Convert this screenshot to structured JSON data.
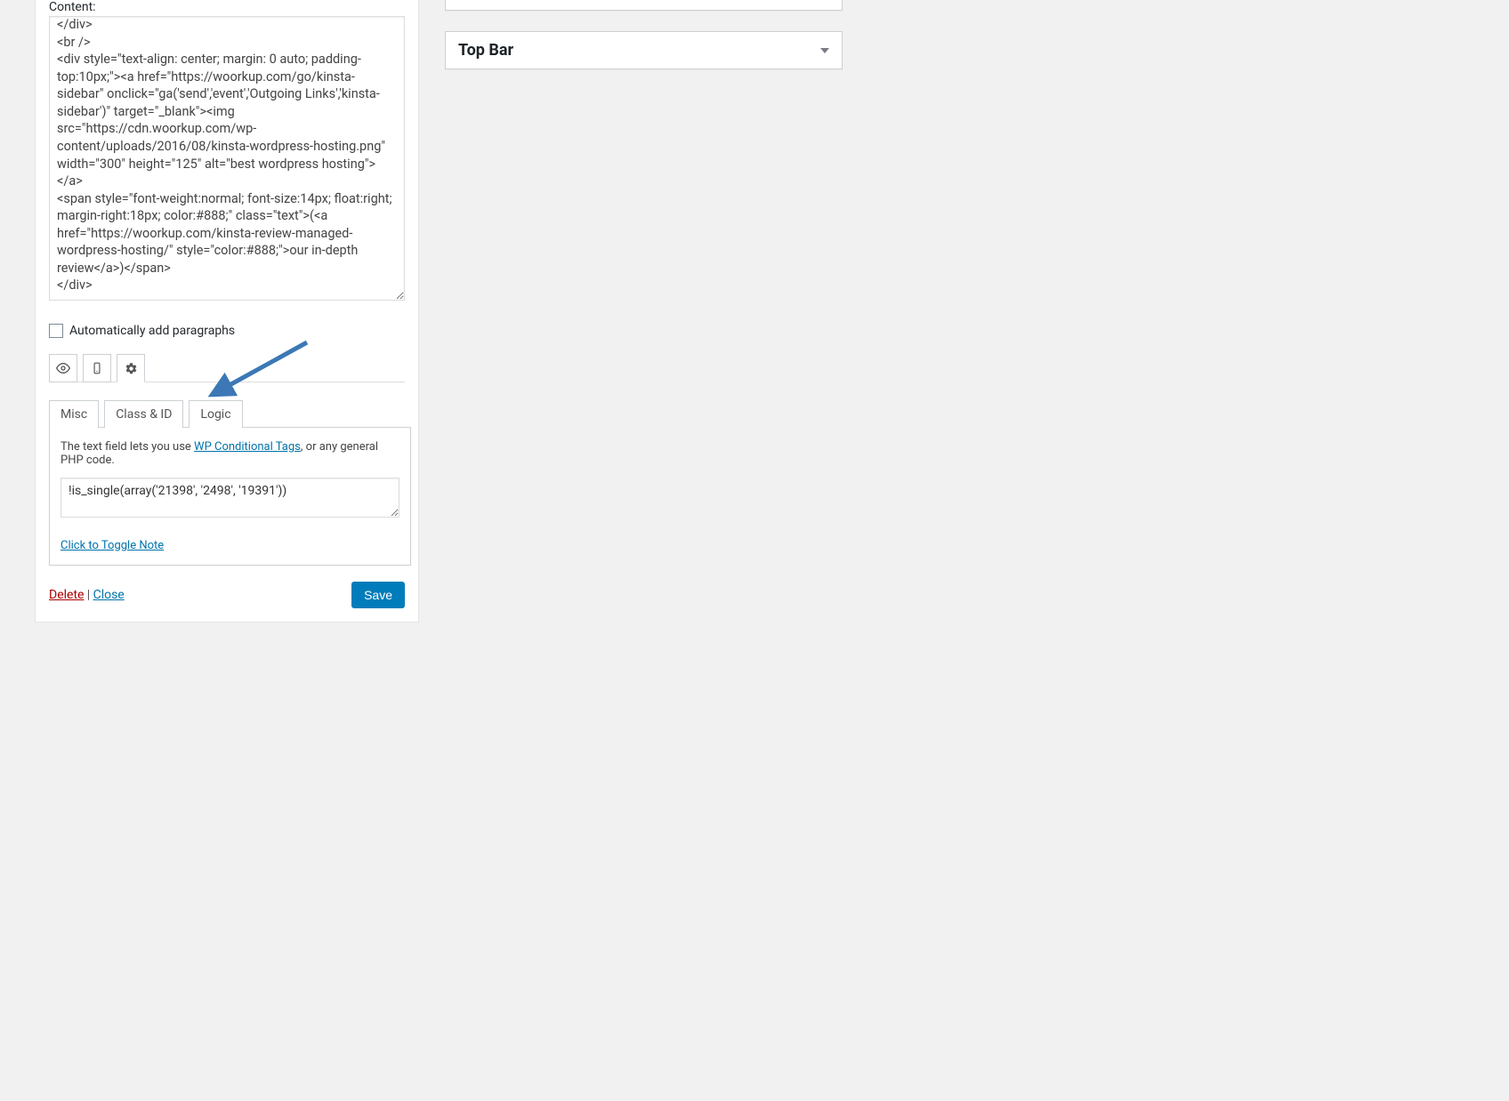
{
  "widget": {
    "content_label": "Content:",
    "content_value": "</div>\n<br />\n<div style=\"text-align: center; margin: 0 auto; padding-top:10px;\"><a href=\"https://woorkup.com/go/kinsta-sidebar\" onclick=\"ga('send','event','Outgoing Links','kinsta-sidebar')\" target=\"_blank\"><img src=\"https://cdn.woorkup.com/wp-content/uploads/2016/08/kinsta-wordpress-hosting.png\" width=\"300\" height=\"125\" alt=\"best wordpress hosting\"></a>\n<span style=\"font-weight:normal; font-size:14px; float:right; margin-right:18px; color:#888;\" class=\"text\">(<a href=\"https://woorkup.com/kinsta-review-managed-wordpress-hosting/\" style=\"color:#888;\">our in-depth review</a>)</span>\n</div>",
    "auto_paragraphs_label": "Automatically add paragraphs",
    "auto_paragraphs_checked": false,
    "sub_tabs": [
      "Misc",
      "Class & ID",
      "Logic"
    ],
    "active_sub_tab": 2,
    "logic_help_pre": "The text field lets you use ",
    "logic_help_link": "WP Conditional Tags",
    "logic_help_post": ", or any general PHP code.",
    "logic_value": "!is_single(array('21398', '2498', '19391'))",
    "toggle_note_label": "Click to Toggle Note",
    "delete_label": "Delete",
    "close_label": "Close",
    "save_label": "Save"
  },
  "meta": {
    "topbar_title": "Top Bar"
  }
}
